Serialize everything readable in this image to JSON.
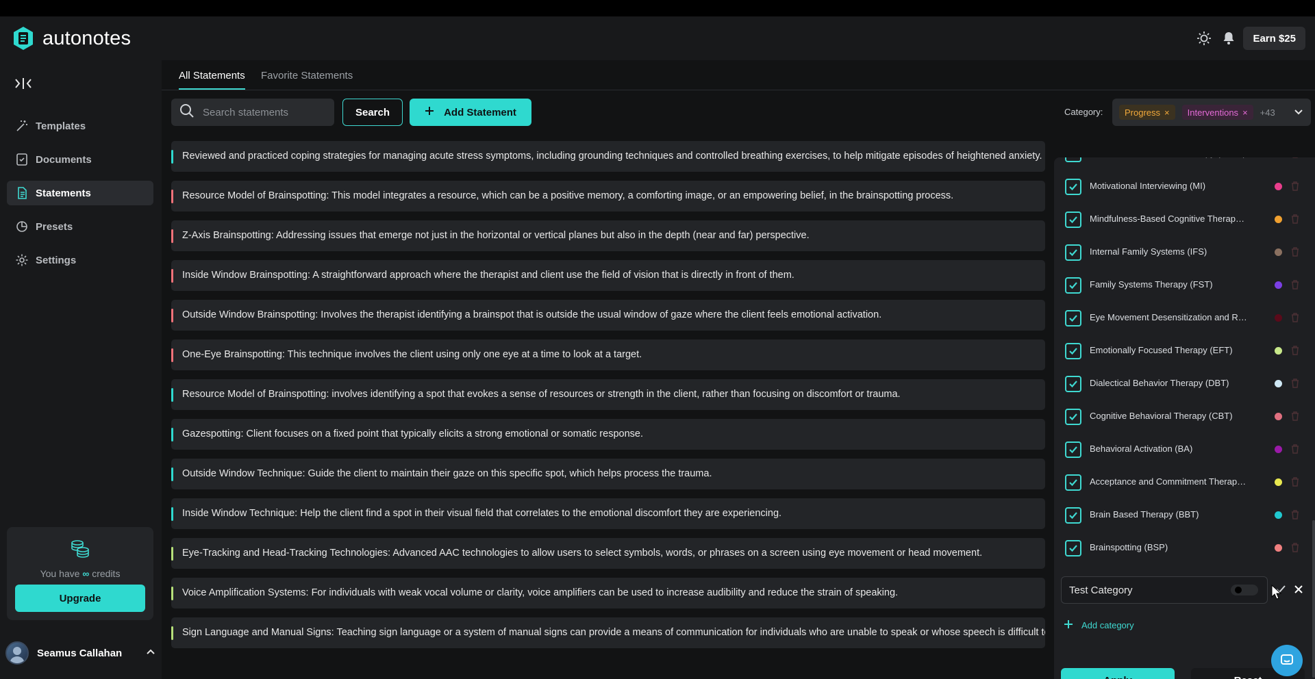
{
  "app": {
    "name": "autonotes"
  },
  "header": {
    "earn_label": "Earn $25"
  },
  "sidebar": {
    "items": [
      {
        "label": "Templates",
        "icon": "wand-icon"
      },
      {
        "label": "Documents",
        "icon": "document-check-icon"
      },
      {
        "label": "Statements",
        "icon": "statements-icon",
        "active": true
      },
      {
        "label": "Presets",
        "icon": "presets-icon"
      },
      {
        "label": "Settings",
        "icon": "gear-icon"
      }
    ],
    "credits": {
      "prefix": "You have",
      "infinity": "∞",
      "suffix": "credits"
    },
    "upgrade_label": "Upgrade",
    "user": {
      "name": "Seamus Callahan"
    }
  },
  "main": {
    "tabs": [
      {
        "label": "All Statements",
        "active": true
      },
      {
        "label": "Favorite Statements"
      }
    ],
    "search": {
      "placeholder": "Search statements",
      "value": ""
    },
    "search_button": "Search",
    "add_button": "Add Statement",
    "category": {
      "label": "Category:",
      "chips": [
        {
          "label": "Progress",
          "remove": "×"
        },
        {
          "label": "Interventions",
          "remove": "×"
        }
      ],
      "more": "+43"
    },
    "statements": [
      {
        "text": "Reviewed and practiced coping strategies for managing acute stress symptoms, including grounding techniques and controlled breathing exercises, to help mitigate episodes of heightened anxiety.",
        "color": "#2fd9cf"
      },
      {
        "text": "Resource Model of Brainspotting: This model integrates a resource, which can be a positive memory, a comforting image, or an empowering belief, in the brainspotting process.",
        "color": "#f0727a"
      },
      {
        "text": "Z-Axis Brainspotting: Addressing issues that emerge not just in the horizontal or vertical planes but also in the depth (near and far) perspective.",
        "color": "#f0727a"
      },
      {
        "text": "Inside Window Brainspotting: A straightforward approach where the therapist and client use the field of vision that is directly in front of them.",
        "color": "#f0727a"
      },
      {
        "text": "Outside Window Brainspotting: Involves the therapist identifying a brainspot that is outside the usual window of gaze where the client feels emotional activation.",
        "color": "#f0727a"
      },
      {
        "text": "One-Eye Brainspotting: This technique involves the client using only one eye at a time to look at a target.",
        "color": "#f0727a"
      },
      {
        "text": "Resource Model of Brainspotting: involves identifying a spot that evokes a sense of resources or strength in the client, rather than focusing on discomfort or trauma.",
        "color": "#2fd9cf"
      },
      {
        "text": "Gazespotting: Client focuses on a fixed point that typically elicits a strong emotional or somatic response.",
        "color": "#2fd9cf"
      },
      {
        "text": "Outside Window Technique: Guide the client to maintain their gaze on this specific spot, which helps process the trauma.",
        "color": "#2fd9cf"
      },
      {
        "text": "Inside Window Technique: Help the client find a spot in their visual field that correlates to the emotional discomfort they are experiencing.",
        "color": "#2fd9cf"
      },
      {
        "text": "Eye-Tracking and Head-Tracking Technologies: Advanced AAC technologies to allow users to select symbols, words, or phrases on a screen using eye movement or head movement.",
        "color": "#b6e07a"
      },
      {
        "text": "Voice Amplification Systems: For individuals with weak vocal volume or clarity, voice amplifiers can be used to increase audibility and reduce the strain of speaking.",
        "color": "#b6e07a"
      },
      {
        "text": "Sign Language and Manual Signs: Teaching sign language or a system of manual signs can provide a means of communication for individuals who are unable to speak or whose speech is difficult to understand.",
        "color": "#b6e07a"
      }
    ]
  },
  "category_panel": {
    "categories": [
      {
        "name": "Solution-Focused Brief Therapy (SFBT)",
        "color": "#7ed957",
        "checked": true
      },
      {
        "name": "Motivational Interviewing (MI)",
        "color": "#e83e8c",
        "checked": true
      },
      {
        "name": "Mindfulness-Based Cognitive Therapy (MBCT)",
        "color": "#f0a030",
        "checked": true
      },
      {
        "name": "Internal Family Systems (IFS)",
        "color": "#8a7060",
        "checked": true
      },
      {
        "name": "Family Systems Therapy (FST)",
        "color": "#7b3fe4",
        "checked": true
      },
      {
        "name": "Eye Movement Desensitization and Reprocessing (EMDR)",
        "color": "#5a0a1a",
        "checked": true
      },
      {
        "name": "Emotionally Focused Therapy (EFT)",
        "color": "#c8e88a",
        "checked": true
      },
      {
        "name": "Dialectical Behavior Therapy (DBT)",
        "color": "#cfe8f5",
        "checked": true
      },
      {
        "name": "Cognitive Behavioral Therapy (CBT)",
        "color": "#e07080",
        "checked": true
      },
      {
        "name": "Behavioral Activation (BA)",
        "color": "#9a1aa8",
        "checked": true
      },
      {
        "name": "Acceptance and Commitment Therapy (ACT)",
        "color": "#e8e850",
        "checked": true
      },
      {
        "name": "Brain Based Therapy (BBT)",
        "color": "#20c8d0",
        "checked": true
      },
      {
        "name": "Brainspotting (BSP)",
        "color": "#f08080",
        "checked": true
      }
    ],
    "edit": {
      "value": "Test Category",
      "color": "#000000"
    },
    "add_label": "Add category",
    "apply_label": "Apply",
    "reset_label": "Reset"
  }
}
